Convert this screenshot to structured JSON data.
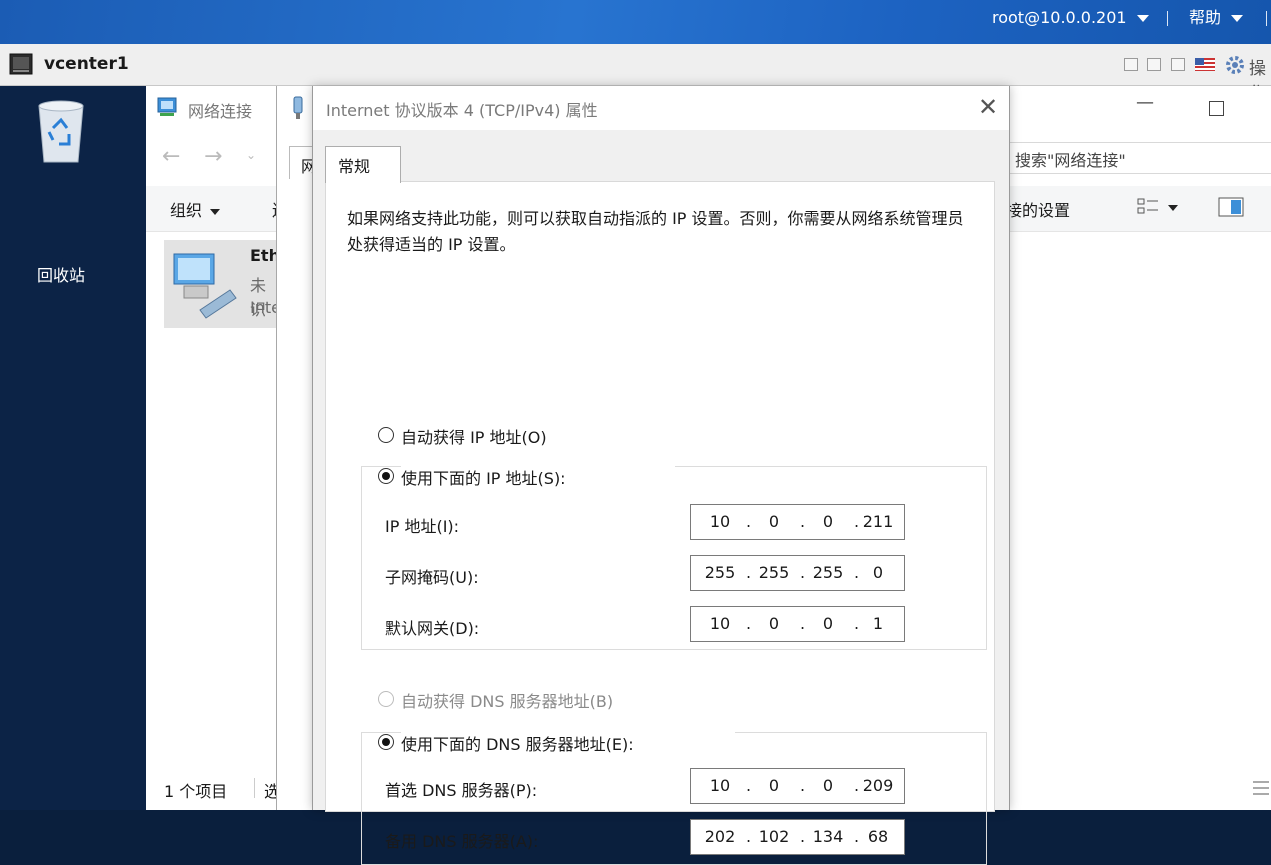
{
  "topbar": {
    "user": "root@10.0.0.201",
    "help": "帮助"
  },
  "vm": {
    "name": "vcenter1",
    "actions_label": "操作"
  },
  "desktop": {
    "recycle_bin": "回收站"
  },
  "explorer": {
    "title": "网络连接",
    "search_placeholder": "搜索\"网络连接\"",
    "organize": "组织",
    "organize_partial": "连",
    "settings_partial": "接的设置",
    "item_name": "Eth",
    "item_status": "未识",
    "item_adapter": "Inte",
    "status_count": "1 个项目",
    "status_partial": "选"
  },
  "back_dialog": {
    "tab_partial": "网"
  },
  "dialog": {
    "title": "Internet 协议版本 4 (TCP/IPv4) 属性",
    "tab": "常规",
    "description": "如果网络支持此功能，则可以获取自动指派的 IP 设置。否则，你需要从网络系统管理员处获得适当的 IP 设置。",
    "auto_ip": "自动获得 IP 地址(O)",
    "manual_ip": "使用下面的 IP 地址(S):",
    "ip_label": "IP 地址(I):",
    "ip": [
      "10",
      "0",
      "0",
      "211"
    ],
    "mask_label": "子网掩码(U):",
    "mask": [
      "255",
      "255",
      "255",
      "0"
    ],
    "gateway_label": "默认网关(D):",
    "gateway": [
      "10",
      "0",
      "0",
      "1"
    ],
    "auto_dns": "自动获得 DNS 服务器地址(B)",
    "manual_dns": "使用下面的 DNS 服务器地址(E):",
    "dns1_label": "首选 DNS 服务器(P):",
    "dns1": [
      "10",
      "0",
      "0",
      "209"
    ],
    "dns2_label": "备用 DNS 服务器(A):",
    "dns2": [
      "202",
      "102",
      "134",
      "68"
    ]
  },
  "colors": {
    "topbar": "#2874d0",
    "desktop": "#0c2346",
    "dialog_bg": "#f0f0f0"
  }
}
